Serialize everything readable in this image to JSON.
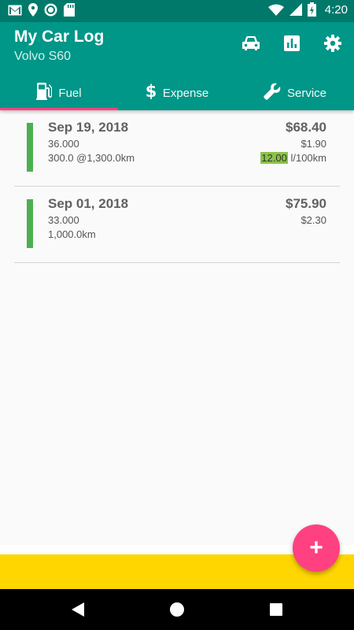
{
  "status_bar": {
    "time": "4:20",
    "icons": [
      "gmail-icon",
      "location-icon",
      "circle-app-icon",
      "sd-card-icon",
      "wifi-icon",
      "signal-icon",
      "battery-charging-icon"
    ]
  },
  "app": {
    "title": "My Car Log",
    "subtitle": "Volvo S60",
    "actions": [
      "car-icon",
      "chart-icon",
      "settings-icon"
    ]
  },
  "tabs": [
    {
      "label": "Fuel",
      "icon": "fuel-pump-icon",
      "selected": true
    },
    {
      "label": "Expense",
      "icon": "dollar-icon",
      "selected": false
    },
    {
      "label": "Service",
      "icon": "wrench-icon",
      "selected": false
    }
  ],
  "entries": [
    {
      "date": "Sep 19, 2018",
      "odometer": "36.000",
      "distance": "300.0 @1,300.0km",
      "cost": "$68.40",
      "price": "$1.90",
      "consumption_value": "12.00",
      "consumption_unit": "l/100km"
    },
    {
      "date": "Sep 01, 2018",
      "odometer": "33.000",
      "distance": "1,000.0km",
      "cost": "$75.90",
      "price": "$2.30"
    }
  ],
  "fab": {
    "label": "+"
  },
  "colors": {
    "primary": "#009688",
    "primary_dark": "#00796b",
    "accent": "#ff4081",
    "entry_bar": "#4caf50",
    "highlight": "#8bc34a",
    "ad_banner": "#ffd600"
  },
  "nav": [
    "back-icon",
    "home-icon",
    "recents-icon"
  ]
}
